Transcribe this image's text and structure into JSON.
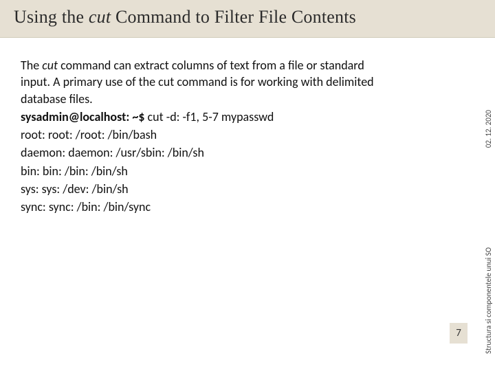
{
  "title": {
    "pre": "Using the ",
    "em": "cut",
    "post": " Command to Filter File Contents"
  },
  "body": {
    "intro_pre": "The ",
    "intro_cmd": "cut",
    "intro_post": " command can extract columns of text from a file or standard input. A primary use of the cut command is for working with delimited database files.",
    "prompt": "sysadmin@localhost: ~$",
    "cmd_rest": " cut -d: -f1, 5-7 mypasswd",
    "lines": [
      "root: root: /root: /bin/bash",
      "daemon: daemon: /usr/sbin: /bin/sh",
      "bin: bin: /bin: /bin/sh",
      "sys: sys: /dev: /bin/sh",
      "sync: sync: /bin: /bin/sync"
    ]
  },
  "side": {
    "date": "02. 12. 2020",
    "course": "Structura si componentele unui SO"
  },
  "page": "7"
}
